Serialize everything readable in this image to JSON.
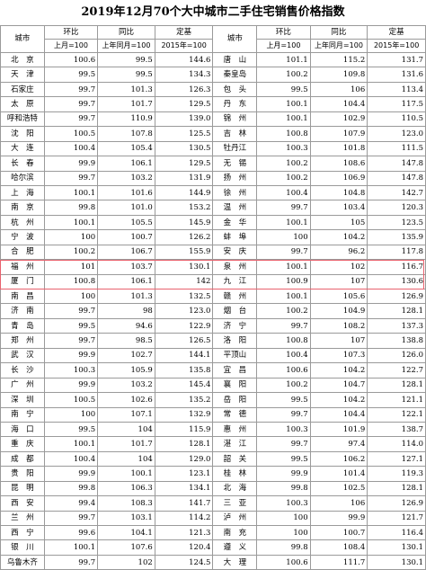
{
  "title": "2019年12月70个大中城市二手住宅销售价格指数",
  "headers": {
    "city": "城市",
    "mom": "环比",
    "yoy": "同比",
    "fixed": "定基",
    "mom_sub": "上月=100",
    "yoy_sub": "上年同月=100",
    "fixed_sub": "2015年=100"
  },
  "highlight_color": "#e8626e",
  "rows": [
    [
      {
        "city": "北　京",
        "mom": "100.6",
        "yoy": "99.5",
        "base": "144.6"
      },
      {
        "city": "唐　山",
        "mom": "101.1",
        "yoy": "115.2",
        "base": "131.7"
      }
    ],
    [
      {
        "city": "天　津",
        "mom": "99.5",
        "yoy": "99.5",
        "base": "134.3"
      },
      {
        "city": "秦皇岛",
        "mom": "100.2",
        "yoy": "109.8",
        "base": "131.6"
      }
    ],
    [
      {
        "city": "石家庄",
        "mom": "99.7",
        "yoy": "101.3",
        "base": "126.3"
      },
      {
        "city": "包　头",
        "mom": "99.5",
        "yoy": "106",
        "base": "113.4"
      }
    ],
    [
      {
        "city": "太　原",
        "mom": "99.7",
        "yoy": "101.7",
        "base": "129.5"
      },
      {
        "city": "丹　东",
        "mom": "100.1",
        "yoy": "104.4",
        "base": "117.5"
      }
    ],
    [
      {
        "city": "呼和浩特",
        "mom": "99.7",
        "yoy": "110.9",
        "base": "139.0"
      },
      {
        "city": "锦　州",
        "mom": "100.1",
        "yoy": "102.9",
        "base": "110.5"
      }
    ],
    [
      {
        "city": "沈　阳",
        "mom": "100.5",
        "yoy": "107.8",
        "base": "125.5"
      },
      {
        "city": "吉　林",
        "mom": "100.8",
        "yoy": "107.9",
        "base": "123.0"
      }
    ],
    [
      {
        "city": "大　连",
        "mom": "100.4",
        "yoy": "105.4",
        "base": "130.5"
      },
      {
        "city": "牡丹江",
        "mom": "100.3",
        "yoy": "101.8",
        "base": "111.5"
      }
    ],
    [
      {
        "city": "长　春",
        "mom": "99.9",
        "yoy": "106.1",
        "base": "129.5"
      },
      {
        "city": "无　锡",
        "mom": "100.2",
        "yoy": "108.6",
        "base": "147.8"
      }
    ],
    [
      {
        "city": "哈尔滨",
        "mom": "99.7",
        "yoy": "103.2",
        "base": "131.9"
      },
      {
        "city": "扬　州",
        "mom": "100.2",
        "yoy": "106.9",
        "base": "147.8"
      }
    ],
    [
      {
        "city": "上　海",
        "mom": "100.1",
        "yoy": "101.6",
        "base": "144.9"
      },
      {
        "city": "徐　州",
        "mom": "100.4",
        "yoy": "104.8",
        "base": "142.7"
      }
    ],
    [
      {
        "city": "南　京",
        "mom": "99.8",
        "yoy": "101.0",
        "base": "153.2"
      },
      {
        "city": "温　州",
        "mom": "99.7",
        "yoy": "103.4",
        "base": "120.3"
      }
    ],
    [
      {
        "city": "杭　州",
        "mom": "100.1",
        "yoy": "105.5",
        "base": "145.9"
      },
      {
        "city": "金　华",
        "mom": "100.1",
        "yoy": "105",
        "base": "123.5"
      }
    ],
    [
      {
        "city": "宁　波",
        "mom": "100",
        "yoy": "100.7",
        "base": "126.2"
      },
      {
        "city": "蚌　埠",
        "mom": "100",
        "yoy": "104.2",
        "base": "135.9"
      }
    ],
    [
      {
        "city": "合　肥",
        "mom": "100.2",
        "yoy": "106.7",
        "base": "155.9"
      },
      {
        "city": "安　庆",
        "mom": "99.7",
        "yoy": "96.2",
        "base": "117.8"
      }
    ],
    [
      {
        "city": "福　州",
        "mom": "101",
        "yoy": "103.7",
        "base": "130.1"
      },
      {
        "city": "泉　州",
        "mom": "100.1",
        "yoy": "102",
        "base": "116.7"
      }
    ],
    [
      {
        "city": "厦　门",
        "mom": "100.8",
        "yoy": "106.1",
        "base": "142"
      },
      {
        "city": "九　江",
        "mom": "100.9",
        "yoy": "107",
        "base": "130.6"
      }
    ],
    [
      {
        "city": "南　昌",
        "mom": "100",
        "yoy": "101.3",
        "base": "132.5"
      },
      {
        "city": "赣　州",
        "mom": "100.1",
        "yoy": "105.6",
        "base": "126.9"
      }
    ],
    [
      {
        "city": "济　南",
        "mom": "99.7",
        "yoy": "98",
        "base": "123.0"
      },
      {
        "city": "烟　台",
        "mom": "100.2",
        "yoy": "104.9",
        "base": "128.1"
      }
    ],
    [
      {
        "city": "青　岛",
        "mom": "99.5",
        "yoy": "94.6",
        "base": "122.9"
      },
      {
        "city": "济　宁",
        "mom": "99.7",
        "yoy": "108.2",
        "base": "137.3"
      }
    ],
    [
      {
        "city": "郑　州",
        "mom": "99.7",
        "yoy": "98.5",
        "base": "126.5"
      },
      {
        "city": "洛　阳",
        "mom": "100.8",
        "yoy": "107",
        "base": "138.8"
      }
    ],
    [
      {
        "city": "武　汉",
        "mom": "99.9",
        "yoy": "102.7",
        "base": "144.1"
      },
      {
        "city": "平顶山",
        "mom": "100.4",
        "yoy": "107.3",
        "base": "126.0"
      }
    ],
    [
      {
        "city": "长　沙",
        "mom": "100.3",
        "yoy": "105.9",
        "base": "135.8"
      },
      {
        "city": "宜　昌",
        "mom": "100.6",
        "yoy": "104.2",
        "base": "122.7"
      }
    ],
    [
      {
        "city": "广　州",
        "mom": "99.9",
        "yoy": "103.2",
        "base": "145.4"
      },
      {
        "city": "襄　阳",
        "mom": "100.2",
        "yoy": "104.7",
        "base": "128.1"
      }
    ],
    [
      {
        "city": "深　圳",
        "mom": "100.5",
        "yoy": "102.6",
        "base": "135.2"
      },
      {
        "city": "岳　阳",
        "mom": "99.5",
        "yoy": "104.2",
        "base": "121.1"
      }
    ],
    [
      {
        "city": "南　宁",
        "mom": "100",
        "yoy": "107.1",
        "base": "132.9"
      },
      {
        "city": "常　德",
        "mom": "99.7",
        "yoy": "104.4",
        "base": "122.1"
      }
    ],
    [
      {
        "city": "海　口",
        "mom": "99.5",
        "yoy": "104",
        "base": "115.9"
      },
      {
        "city": "惠　州",
        "mom": "100.3",
        "yoy": "101.9",
        "base": "138.7"
      }
    ],
    [
      {
        "city": "重　庆",
        "mom": "100.1",
        "yoy": "101.7",
        "base": "128.1"
      },
      {
        "city": "湛　江",
        "mom": "99.7",
        "yoy": "97.4",
        "base": "114.0"
      }
    ],
    [
      {
        "city": "成　都",
        "mom": "100.4",
        "yoy": "104",
        "base": "129.0"
      },
      {
        "city": "韶　关",
        "mom": "99.5",
        "yoy": "106.2",
        "base": "127.1"
      }
    ],
    [
      {
        "city": "贵　阳",
        "mom": "99.9",
        "yoy": "100.1",
        "base": "123.1"
      },
      {
        "city": "桂　林",
        "mom": "99.9",
        "yoy": "101.4",
        "base": "119.3"
      }
    ],
    [
      {
        "city": "昆　明",
        "mom": "99.8",
        "yoy": "106.3",
        "base": "134.1"
      },
      {
        "city": "北　海",
        "mom": "99.8",
        "yoy": "102.5",
        "base": "128.1"
      }
    ],
    [
      {
        "city": "西　安",
        "mom": "99.4",
        "yoy": "108.3",
        "base": "141.7"
      },
      {
        "city": "三　亚",
        "mom": "100.3",
        "yoy": "106",
        "base": "126.9"
      }
    ],
    [
      {
        "city": "兰　州",
        "mom": "99.7",
        "yoy": "103.1",
        "base": "114.2"
      },
      {
        "city": "泸　州",
        "mom": "100",
        "yoy": "99.9",
        "base": "121.7"
      }
    ],
    [
      {
        "city": "西　宁",
        "mom": "99.6",
        "yoy": "104.1",
        "base": "121.3"
      },
      {
        "city": "南　充",
        "mom": "100",
        "yoy": "100.7",
        "base": "116.4"
      }
    ],
    [
      {
        "city": "银　川",
        "mom": "100.1",
        "yoy": "107.6",
        "base": "120.4"
      },
      {
        "city": "遵　义",
        "mom": "99.8",
        "yoy": "108.4",
        "base": "130.1"
      }
    ],
    [
      {
        "city": "乌鲁木齐",
        "mom": "99.7",
        "yoy": "102",
        "base": "124.5"
      },
      {
        "city": "大　理",
        "mom": "100.6",
        "yoy": "111.7",
        "base": "130.1"
      }
    ]
  ]
}
